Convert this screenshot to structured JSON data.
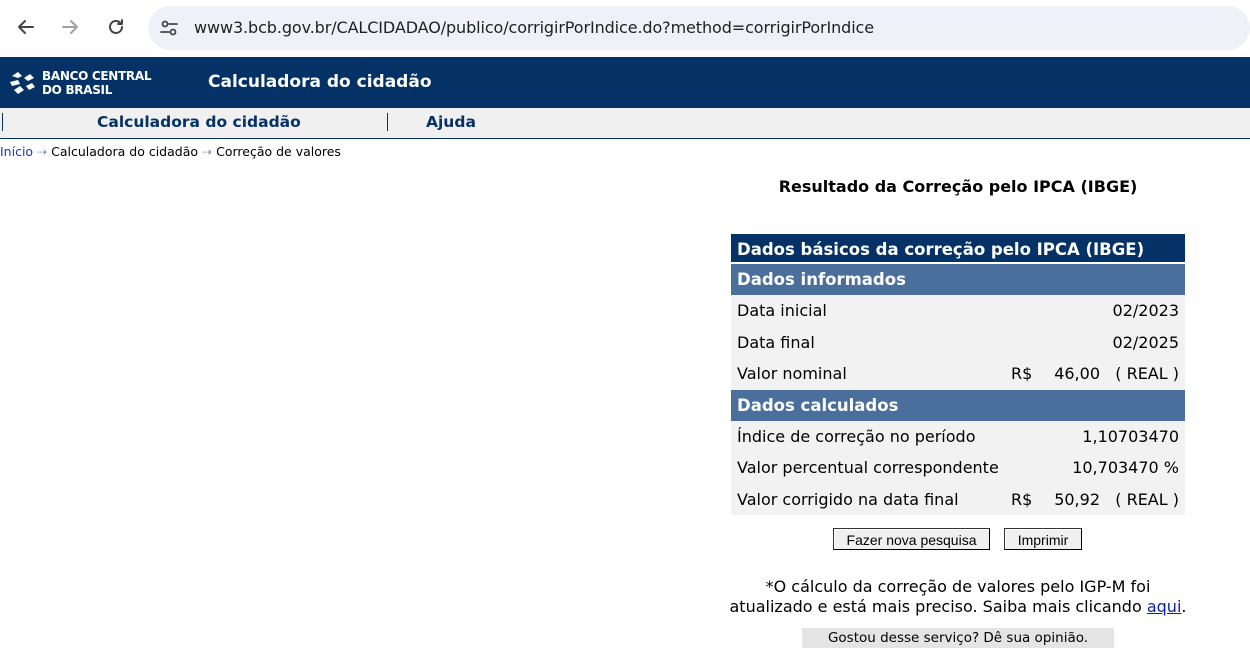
{
  "browser": {
    "url": "www3.bcb.gov.br/CALCIDADAO/publico/corrigirPorIndice.do?method=corrigirPorIndice"
  },
  "header": {
    "logo_line1": "BANCO CENTRAL",
    "logo_line2": "DO BRASIL",
    "title": "Calculadora do cidadão"
  },
  "menu": {
    "items": [
      {
        "label": "Calculadora do cidadão"
      },
      {
        "label": "Ajuda"
      }
    ]
  },
  "breadcrumb": {
    "items": [
      "Início",
      "Calculadora do cidadão",
      "Correção de valores"
    ],
    "separator": "⇢"
  },
  "result": {
    "title": "Resultado da Correção pelo IPCA (IBGE)",
    "table_header": "Dados básicos da correção pelo IPCA (IBGE)",
    "informed_header": "Dados informados",
    "informed": [
      {
        "label": "Data inicial",
        "value": "02/2023"
      },
      {
        "label": "Data final",
        "value": "02/2025"
      },
      {
        "label": "Valor nominal",
        "currency": "R$",
        "value": "46,00   ( REAL )"
      }
    ],
    "calculated_header": "Dados calculados",
    "calculated": [
      {
        "label": "Índice de correção no período",
        "value": "1,10703470"
      },
      {
        "label": "Valor percentual correspondente",
        "value": "10,703470 %"
      },
      {
        "label": "Valor corrigido na data final",
        "currency": "R$",
        "value": "50,92   ( REAL )"
      }
    ]
  },
  "buttons": {
    "new_search": "Fazer nova pesquisa",
    "print": "Imprimir"
  },
  "note": {
    "text_before": "*O cálculo da correção de valores pelo IGP-M foi atualizado e está mais preciso. Saiba mais clicando ",
    "link": "aqui",
    "text_after": "."
  },
  "feedback": {
    "label": "Gostou desse serviço? Dê sua opinião."
  },
  "colors": {
    "navy": "#043266",
    "steel_blue": "#4a6f9c",
    "row_gray": "#f2f2f2"
  }
}
